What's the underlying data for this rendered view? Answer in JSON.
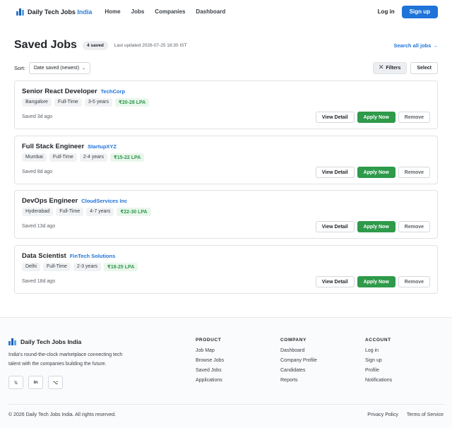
{
  "nav": {
    "brand_name": "Daily Tech Jobs",
    "brand_accent": "India",
    "links": [
      "Home",
      "Jobs",
      "Companies",
      "Dashboard"
    ],
    "login_label": "Log in",
    "signup_label": "Sign up"
  },
  "header": {
    "title": "Saved Jobs",
    "count_badge": "4 saved",
    "last_updated": "Last updated 2026-07-25 18:30 IST",
    "search_all": "Search all jobs →"
  },
  "sortbar": {
    "sort_label": "Sort:",
    "sort_value": "Date saved (newest)",
    "filters_label": "Filters",
    "select_label": "Select"
  },
  "jobs": [
    {
      "title": "Senior React Developer",
      "company": "TechCorp",
      "location": "Bangalore",
      "type": "Full-Time",
      "experience": "3-5 years",
      "salary": "₹20-28 LPA",
      "saved": "Saved 3d ago"
    },
    {
      "title": "Full Stack Engineer",
      "company": "StartupXYZ",
      "location": "Mumbai",
      "type": "Full-Time",
      "experience": "2-4 years",
      "salary": "₹15-22 LPA",
      "saved": "Saved 8d ago"
    },
    {
      "title": "DevOps Engineer",
      "company": "CloudServices Inc",
      "location": "Hyderabad",
      "type": "Full-Time",
      "experience": "4-7 years",
      "salary": "₹22-30 LPA",
      "saved": "Saved 13d ago"
    },
    {
      "title": "Data Scientist",
      "company": "FinTech Solutions",
      "location": "Delhi",
      "type": "Full-Time",
      "experience": "2-3 years",
      "salary": "₹18-25 LPA",
      "saved": "Saved 18d ago"
    }
  ],
  "job_actions": {
    "view_label": "View Detail",
    "apply_label": "Apply Now",
    "remove_label": "Remove"
  },
  "footer": {
    "brand": "Daily Tech Jobs India",
    "description": "India's round-the-clock marketplace connecting tech talent with the companies building the future.",
    "socials": [
      "𝕏",
      "in",
      "⌥"
    ],
    "columns": [
      {
        "title": "PRODUCT",
        "links": [
          "Job Map",
          "Browse Jobs",
          "Saved Jobs",
          "Applications"
        ]
      },
      {
        "title": "COMPANY",
        "links": [
          "Dashboard",
          "Company Profile",
          "Candidates",
          "Reports"
        ]
      },
      {
        "title": "ACCOUNT",
        "links": [
          "Log in",
          "Sign up",
          "Profile",
          "Notifications"
        ]
      }
    ],
    "copyright": "© 2026 Daily Tech Jobs India. All rights reserved.",
    "legal": [
      "Privacy Policy",
      "Terms of Service"
    ]
  },
  "colors": {
    "primary": "#1f73d9",
    "success": "#2e9a4a"
  }
}
